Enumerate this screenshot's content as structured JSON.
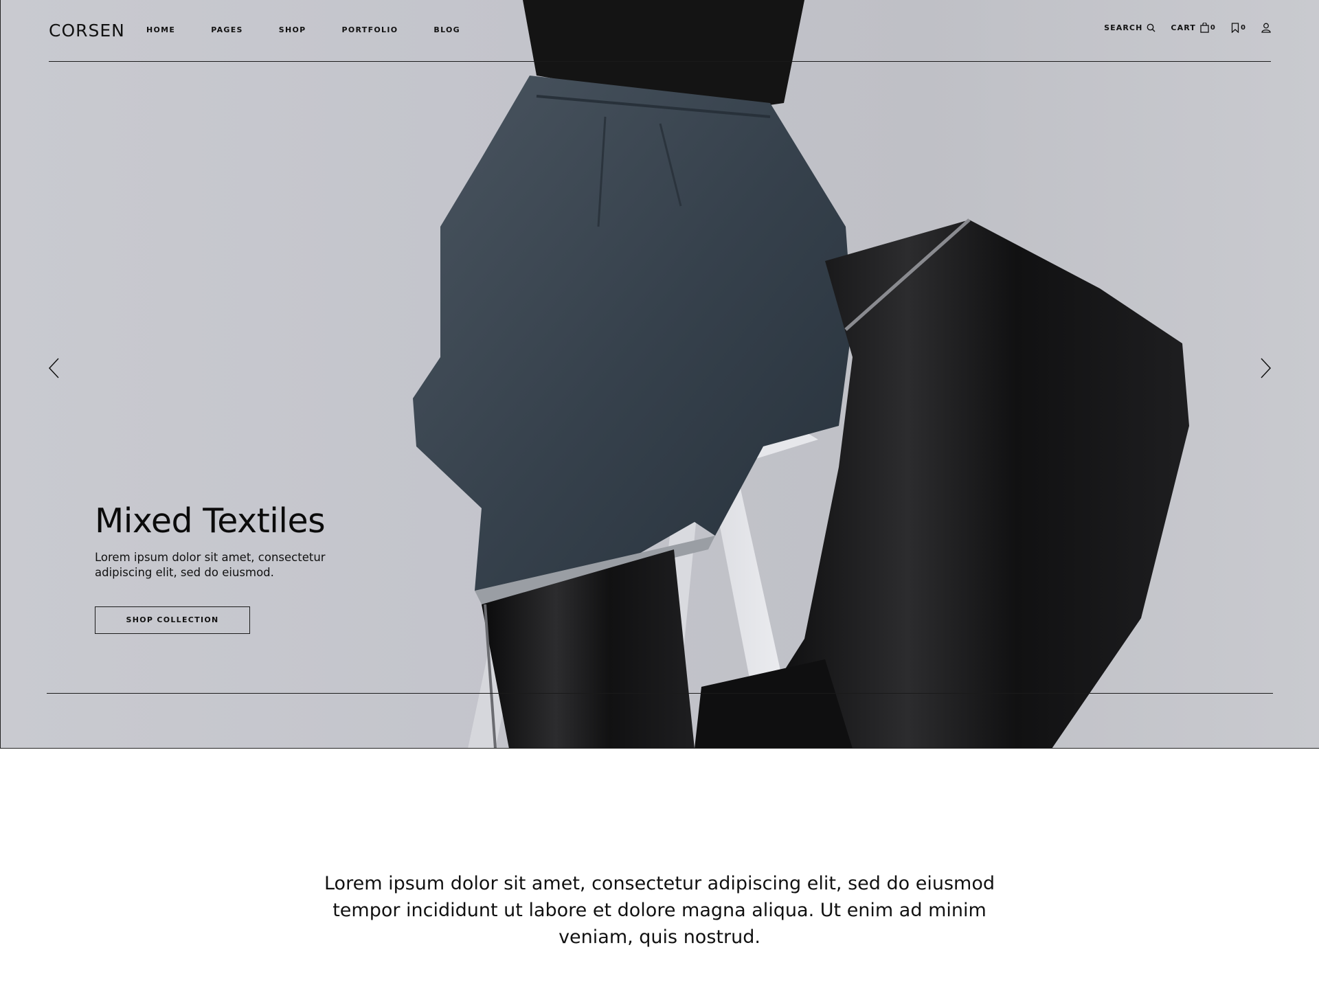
{
  "brand": {
    "logo": "CORSEN"
  },
  "nav": {
    "items": [
      {
        "label": "HOME"
      },
      {
        "label": "PAGES"
      },
      {
        "label": "SHOP"
      },
      {
        "label": "PORTFOLIO"
      },
      {
        "label": "BLOG"
      }
    ]
  },
  "utilities": {
    "search_label": "SEARCH",
    "cart_label": "CART",
    "cart_count": "0",
    "wishlist_count": "0",
    "icons": [
      "search-icon",
      "shopping-bag-icon",
      "bookmark-icon",
      "user-icon"
    ]
  },
  "hero": {
    "title": "Mixed Textiles",
    "subtitle": "Lorem ipsum dolor sit amet, consectetur adipiscing elit, sed do eiusmod.",
    "cta_label": "SHOP COLLECTION",
    "image": "model-seated-on-stool-denim-and-leather",
    "prev_icon": "chevron-left-icon",
    "next_icon": "chevron-right-icon"
  },
  "intro": {
    "text": "Lorem ipsum dolor sit amet, consectetur adipiscing elit, sed do eiusmod tempor incididunt ut labore et dolore magna aliqua. Ut enim ad minim veniam, quis nostrud."
  },
  "colors": {
    "text": "#111111",
    "hero_bg": "#c4c5cb",
    "page_bg": "#ffffff"
  }
}
